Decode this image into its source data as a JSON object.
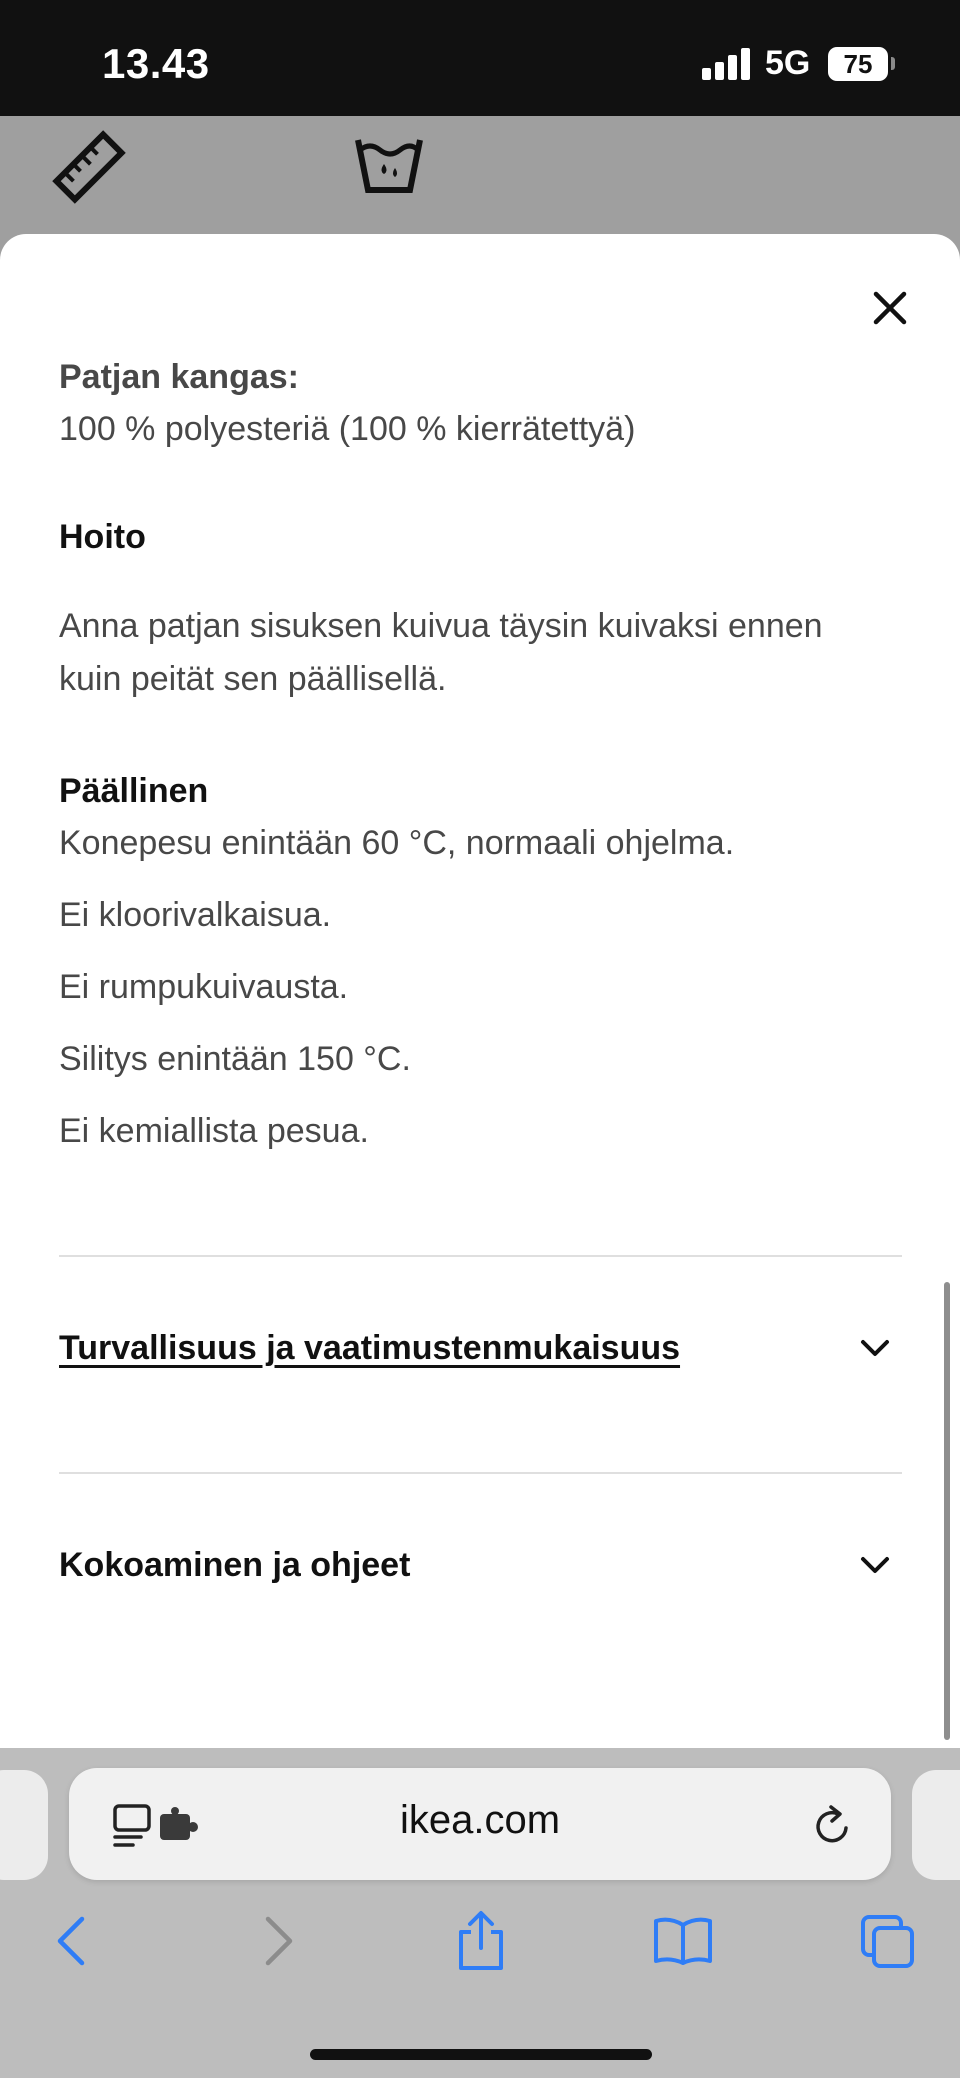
{
  "status_bar": {
    "time": "13.43",
    "network": "5G",
    "battery": "75"
  },
  "sheet": {
    "clipped_heading": "Patjan kangas:",
    "material_text": "100 % polyesteriä (100 % kierrätettyä)",
    "care_heading": "Hoito",
    "care_text_line1": "Anna patjan sisuksen kuivua täysin kuivaksi ennen",
    "care_text_line2": "kuin peität sen päällisellä.",
    "cover_heading": "Päällinen",
    "cover_instructions": [
      "Konepesu enintään 60 °C, normaali ohjelma.",
      "Ei kloorivalkaisua.",
      "Ei rumpukuivausta.",
      "Silitys enintään 150 °C.",
      "Ei kemiallista pesua."
    ],
    "accordion": [
      {
        "label": "Turvallisuus ja vaatimustenmukaisuus"
      },
      {
        "label": "Kokoaminen ja ohjeet"
      }
    ]
  },
  "browser": {
    "url": "ikea.com"
  },
  "icons": {
    "close": "close-icon",
    "chevron": "chevron-down-icon",
    "ruler": "ruler-icon",
    "wash": "wash-care-icon",
    "reader": "reader-mode-icon",
    "extension": "extension-icon",
    "reload": "reload-icon",
    "back": "back-icon",
    "forward": "forward-icon",
    "share": "share-icon",
    "bookmarks": "bookmarks-icon",
    "tabs": "tabs-icon"
  },
  "colors": {
    "link_blue": "#2f7df6",
    "disabled_gray": "#8c8c8c",
    "text_dark": "#111111",
    "text_body": "#484848"
  }
}
